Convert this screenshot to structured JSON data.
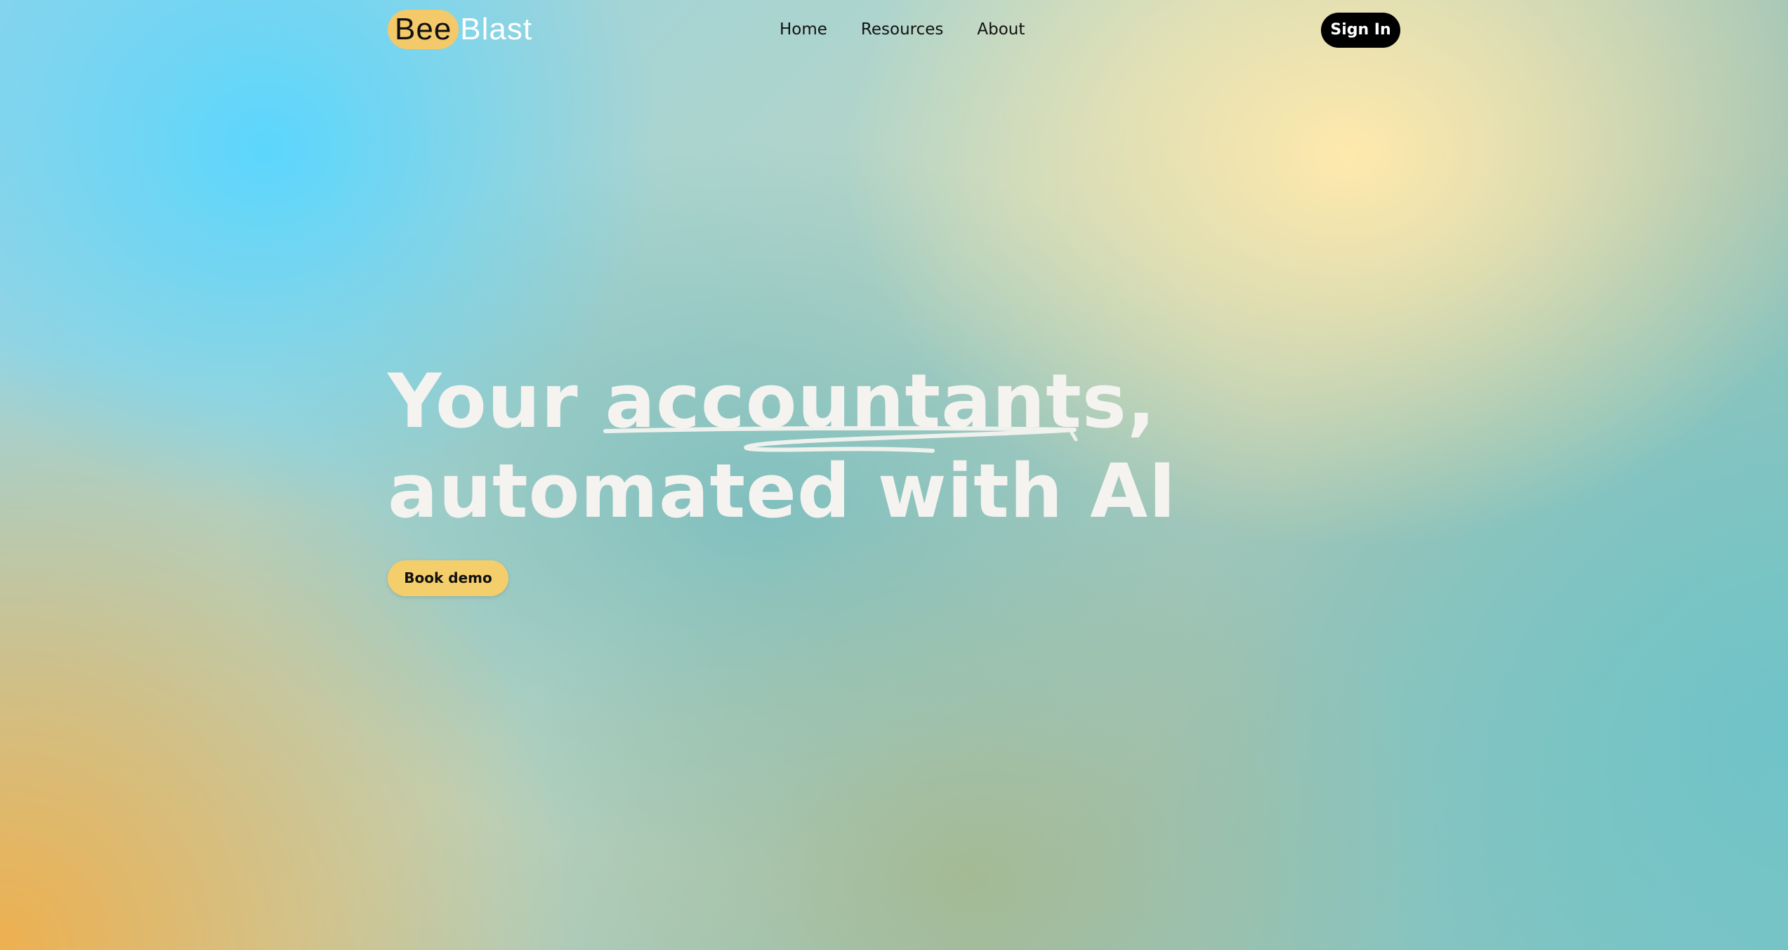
{
  "brand": {
    "name_part1": "Bee",
    "name_part2": "Blast",
    "accent_color": "#f3c96a"
  },
  "nav": {
    "items": [
      {
        "label": "Home"
      },
      {
        "label": "Resources"
      },
      {
        "label": "About"
      }
    ]
  },
  "header": {
    "signin_label": "Sign In"
  },
  "hero": {
    "title_word1": "Your",
    "title_highlight": "accountants,",
    "title_line2": "automated with AI",
    "cta_label": "Book demo",
    "cta_color": "#f4ce6b"
  },
  "icons": {
    "underline": "scribble-underline-icon"
  }
}
